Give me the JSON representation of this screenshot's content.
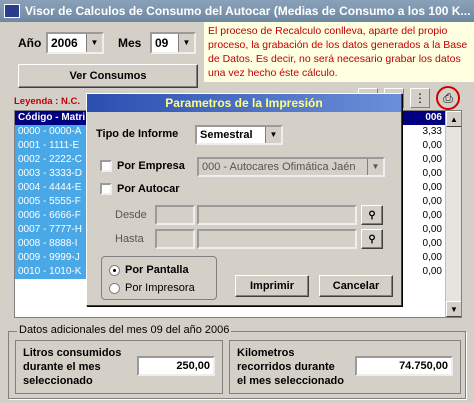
{
  "window": {
    "title": "Visor de Calculos de Consumo del Autocar (Medias de Consumo a los 100 K..."
  },
  "filters": {
    "year_label": "Año",
    "year_value": "2006",
    "month_label": "Mes",
    "month_value": "09"
  },
  "buttons": {
    "ver_consumos": "Ver Consumos"
  },
  "warning_text": "El proceso de Recalculo conlleva, aparte del propio proceso, la grabación de los datos generados a la Base de Datos. Es decir, no será necesario grabar los datos una vez hecho éste cálculo.",
  "legend_text": "Leyenda : N.C.",
  "grid": {
    "header_first": "Código - Matri",
    "header_last": "006",
    "rows": [
      {
        "code": "0000 - 0000-A",
        "val": "3,33"
      },
      {
        "code": "0001 - 1111-E",
        "val": "0,00"
      },
      {
        "code": "0002 - 2222-C",
        "val": "0,00"
      },
      {
        "code": "0003 - 3333-D",
        "val": "0,00"
      },
      {
        "code": "0004 - 4444-E",
        "val": "0,00"
      },
      {
        "code": "0005 - 5555-F",
        "val": "0,00"
      },
      {
        "code": "0006 - 6666-F",
        "val": "0,00"
      },
      {
        "code": "0007 - 7777-H",
        "val": "0,00"
      },
      {
        "code": "0008 - 8888-I",
        "val": "0,00"
      },
      {
        "code": "0009 - 9999-J",
        "val": "0,00"
      },
      {
        "code": "0010 - 1010-K",
        "val": "0,00"
      }
    ]
  },
  "dialog": {
    "title": "Parametros de la Impresión",
    "tipo_label": "Tipo de Informe",
    "tipo_value": "Semestral",
    "por_empresa_label": "Por Empresa",
    "empresa_value": "000 - Autocares Ofimática Jaén",
    "por_autocar_label": "Por Autocar",
    "desde_label": "Desde",
    "hasta_label": "Hasta",
    "por_pantalla_label": "Por Pantalla",
    "por_impresora_label": "Por Impresora",
    "imprimir_label": "Imprimir",
    "cancelar_label": "Cancelar"
  },
  "additional": {
    "caption": "Datos adicionales del mes 09 del año 2006",
    "litros_label": "Litros consumidos durante el mes seleccionado",
    "litros_value": "250,00",
    "km_label": "Kilometros recorridos durante el mes seleccionado",
    "km_value": "74.750,00"
  }
}
